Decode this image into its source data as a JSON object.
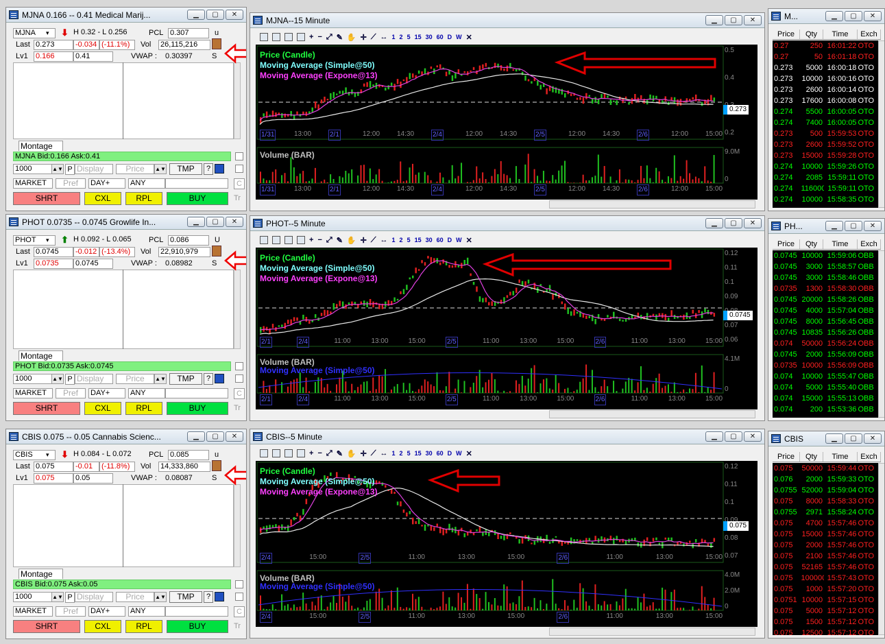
{
  "level2": [
    {
      "title": "MJNA  0.166 -- 0.41  Medical Marij...",
      "symbol": "MJNA",
      "hl": "H 0.32 - L 0.256",
      "pcl_label": "PCL",
      "pcl": "0.307",
      "u": "u",
      "last_label": "Last",
      "last": "0.273",
      "chg": "-0.034",
      "pct": "(-11.1%)",
      "vol_label": "Vol",
      "vol": "26,115,216",
      "lv1_label": "Lv1",
      "bid": "0.166",
      "ask": "0.41",
      "vwap_label": "VWAP :",
      "vwap": "0.30397",
      "s": "S",
      "arrow_dir": "down",
      "montage_label": "Montage",
      "montage": "MJNA Bid:0.166 Ask:0.41"
    },
    {
      "title": "PHOT  0.0735 -- 0.0745  Growlife In...",
      "symbol": "PHOT",
      "hl": "H 0.092 - L 0.065",
      "pcl_label": "PCL",
      "pcl": "0.086",
      "u": "U",
      "last_label": "Last",
      "last": "0.0745",
      "chg": "-0.012",
      "pct": "(-13.4%)",
      "vol_label": "Vol",
      "vol": "22,910,979",
      "lv1_label": "Lv1",
      "bid": "0.0735",
      "ask": "0.0745",
      "vwap_label": "VWAP :",
      "vwap": "0.08982",
      "s": "S",
      "arrow_dir": "up",
      "montage_label": "Montage",
      "montage": "PHOT Bid:0.0735 Ask:0.0745"
    },
    {
      "title": "CBIS  0.075 -- 0.05  Cannabis Scienc...",
      "symbol": "CBIS",
      "hl": "H 0.084 - L 0.072",
      "pcl_label": "PCL",
      "pcl": "0.085",
      "u": "u",
      "last_label": "Last",
      "last": "0.075",
      "chg": "-0.01",
      "pct": "(-11.8%)",
      "vol_label": "Vol",
      "vol": "14,333,860",
      "lv1_label": "Lv1",
      "bid": "0.075",
      "ask": "0.05",
      "vwap_label": "VWAP :",
      "vwap": "0.08087",
      "s": "S",
      "arrow_dir": "down",
      "montage_label": "Montage",
      "montage": "CBIS Bid:0.075 Ask:0.05"
    }
  ],
  "order_entry": {
    "qty": "1000",
    "p": "P",
    "display": "Display",
    "price": "Price",
    "tmp": "TMP",
    "q": "?",
    "order_type": "MARKET",
    "pref": "Pref",
    "tif": "DAY+",
    "route": "ANY",
    "shrt": "SHRT",
    "cxl": "CXL",
    "rpl": "RPL",
    "buy": "BUY",
    "c": "C",
    "tr": "Tr"
  },
  "charts": [
    {
      "title": "MJNA--15 Minute",
      "legend": [
        "Price (Candle)",
        "Moving Average (Simple@50)",
        "Moving Average (Expone@13)"
      ],
      "volume_legend": [
        "Volume (BAR)"
      ],
      "y_ticks": [
        "0.5",
        "0.4",
        "0.3",
        "0.2"
      ],
      "vol_ticks": [
        "9.0M",
        "0"
      ],
      "price_tag": "0.273",
      "x_ticks": [
        "1/31",
        "13:00",
        "2/1",
        "12:00",
        "14:30",
        "2/4",
        "12:00",
        "14:30",
        "2/5",
        "12:00",
        "14:30",
        "2/6",
        "12:00",
        "15:00"
      ]
    },
    {
      "title": "PHOT--5 Minute",
      "legend": [
        "Price (Candle)",
        "Moving Average (Simple@50)",
        "Moving Average (Expone@13)"
      ],
      "volume_legend": [
        "Volume (BAR)",
        "Moving Average (Simple@50)"
      ],
      "y_ticks": [
        "0.12",
        "0.11",
        "0.1",
        "0.09",
        "0.08",
        "0.07",
        "0.06"
      ],
      "vol_ticks": [
        "4.1M",
        "0"
      ],
      "price_tag": "0.0745",
      "x_ticks": [
        "2/1",
        "2/4",
        "11:00",
        "13:00",
        "15:00",
        "2/5",
        "11:00",
        "13:00",
        "15:00",
        "2/6",
        "11:00",
        "13:00",
        "15:00"
      ]
    },
    {
      "title": "CBIS--5 Minute",
      "legend": [
        "Price (Candle)",
        "Moving Average (Simple@50)",
        "Moving Average (Expone@13)"
      ],
      "volume_legend": [
        "Volume (BAR)",
        "Moving Average (Simple@50)"
      ],
      "y_ticks": [
        "0.12",
        "0.11",
        "0.1",
        "0.09",
        "0.08",
        "0.07"
      ],
      "vol_ticks": [
        "4.0M",
        "2.0M",
        "0"
      ],
      "price_tag": "0.075",
      "x_ticks": [
        "2/4",
        "15:00",
        "2/5",
        "11:00",
        "13:00",
        "15:00",
        "2/6",
        "11:00",
        "13:00",
        "15:00"
      ]
    }
  ],
  "toolbar_labels": [
    "1",
    "2",
    "5",
    "15",
    "30",
    "60",
    "D",
    "W"
  ],
  "ts_headers": [
    "Price",
    "Qty",
    "Time",
    "Exch"
  ],
  "timesales": [
    {
      "title": "M...",
      "rows": [
        [
          "0.27",
          "250",
          "16:01:22",
          "OTO",
          "r"
        ],
        [
          "0.27",
          "50",
          "16:01:18",
          "OTO",
          "r"
        ],
        [
          "0.273",
          "5000",
          "16:00:18",
          "OTO",
          "w"
        ],
        [
          "0.273",
          "10000",
          "16:00:16",
          "OTO",
          "w"
        ],
        [
          "0.273",
          "2600",
          "16:00:14",
          "OTO",
          "w"
        ],
        [
          "0.273",
          "17600",
          "16:00:08",
          "OTO",
          "w"
        ],
        [
          "0.274",
          "5500",
          "16:00:05",
          "OTO",
          "g"
        ],
        [
          "0.274",
          "7400",
          "16:00:05",
          "OTO",
          "g"
        ],
        [
          "0.273",
          "500",
          "15:59:53",
          "OTO",
          "r"
        ],
        [
          "0.273",
          "2600",
          "15:59:52",
          "OTO",
          "r"
        ],
        [
          "0.273",
          "15000",
          "15:59:28",
          "OTO",
          "r"
        ],
        [
          "0.274",
          "10000",
          "15:59:26",
          "OTO",
          "g"
        ],
        [
          "0.274",
          "2085",
          "15:59:11",
          "OTO",
          "g"
        ],
        [
          "0.274",
          "116000",
          "15:59:11",
          "OTO",
          "g"
        ],
        [
          "0.274",
          "10000",
          "15:58:35",
          "OTO",
          "g"
        ]
      ]
    },
    {
      "title": "PH...",
      "rows": [
        [
          "0.0745",
          "10000",
          "15:59:06",
          "OBB",
          "g"
        ],
        [
          "0.0745",
          "3000",
          "15:58:57",
          "OBB",
          "g"
        ],
        [
          "0.0745",
          "3000",
          "15:58:46",
          "OBB",
          "g"
        ],
        [
          "0.0735",
          "1300",
          "15:58:30",
          "OBB",
          "r"
        ],
        [
          "0.0745",
          "20000",
          "15:58:26",
          "OBB",
          "g"
        ],
        [
          "0.0745",
          "4000",
          "15:57:04",
          "OBB",
          "g"
        ],
        [
          "0.0745",
          "8000",
          "15:56:45",
          "OBB",
          "g"
        ],
        [
          "0.0745",
          "10835",
          "15:56:26",
          "OBB",
          "g"
        ],
        [
          "0.074",
          "50000",
          "15:56:24",
          "OBB",
          "r"
        ],
        [
          "0.0745",
          "2000",
          "15:56:09",
          "OBB",
          "g"
        ],
        [
          "0.0735",
          "10000",
          "15:56:09",
          "OBB",
          "r"
        ],
        [
          "0.074",
          "10000",
          "15:55:47",
          "OBB",
          "g"
        ],
        [
          "0.074",
          "5000",
          "15:55:40",
          "OBB",
          "g"
        ],
        [
          "0.074",
          "15000",
          "15:55:13",
          "OBB",
          "g"
        ],
        [
          "0.074",
          "200",
          "15:53:36",
          "OBB",
          "g"
        ]
      ]
    },
    {
      "title": "CBIS",
      "rows": [
        [
          "0.075",
          "50000",
          "15:59:44",
          "OTO",
          "r"
        ],
        [
          "0.076",
          "2000",
          "15:59:33",
          "OTO",
          "g"
        ],
        [
          "0.0755",
          "52000",
          "15:59:04",
          "OTO",
          "g"
        ],
        [
          "0.075",
          "8000",
          "15:58:33",
          "OTO",
          "r"
        ],
        [
          "0.0755",
          "2971",
          "15:58:24",
          "OTO",
          "g"
        ],
        [
          "0.075",
          "4700",
          "15:57:46",
          "OTO",
          "r"
        ],
        [
          "0.075",
          "15000",
          "15:57:46",
          "OTO",
          "r"
        ],
        [
          "0.075",
          "2000",
          "15:57:46",
          "OTO",
          "r"
        ],
        [
          "0.075",
          "2100",
          "15:57:46",
          "OTO",
          "r"
        ],
        [
          "0.075",
          "52165",
          "15:57:46",
          "OTO",
          "r"
        ],
        [
          "0.075",
          "100000",
          "15:57:43",
          "OTO",
          "r"
        ],
        [
          "0.075",
          "1000",
          "15:57:20",
          "OTO",
          "r"
        ],
        [
          "0.0751",
          "10000",
          "15:57:15",
          "OTO",
          "r"
        ],
        [
          "0.075",
          "5000",
          "15:57:12",
          "OTO",
          "r"
        ],
        [
          "0.075",
          "1500",
          "15:57:12",
          "OTO",
          "r"
        ],
        [
          "0.075",
          "12500",
          "15:57:12",
          "OTO",
          "r"
        ]
      ]
    }
  ]
}
